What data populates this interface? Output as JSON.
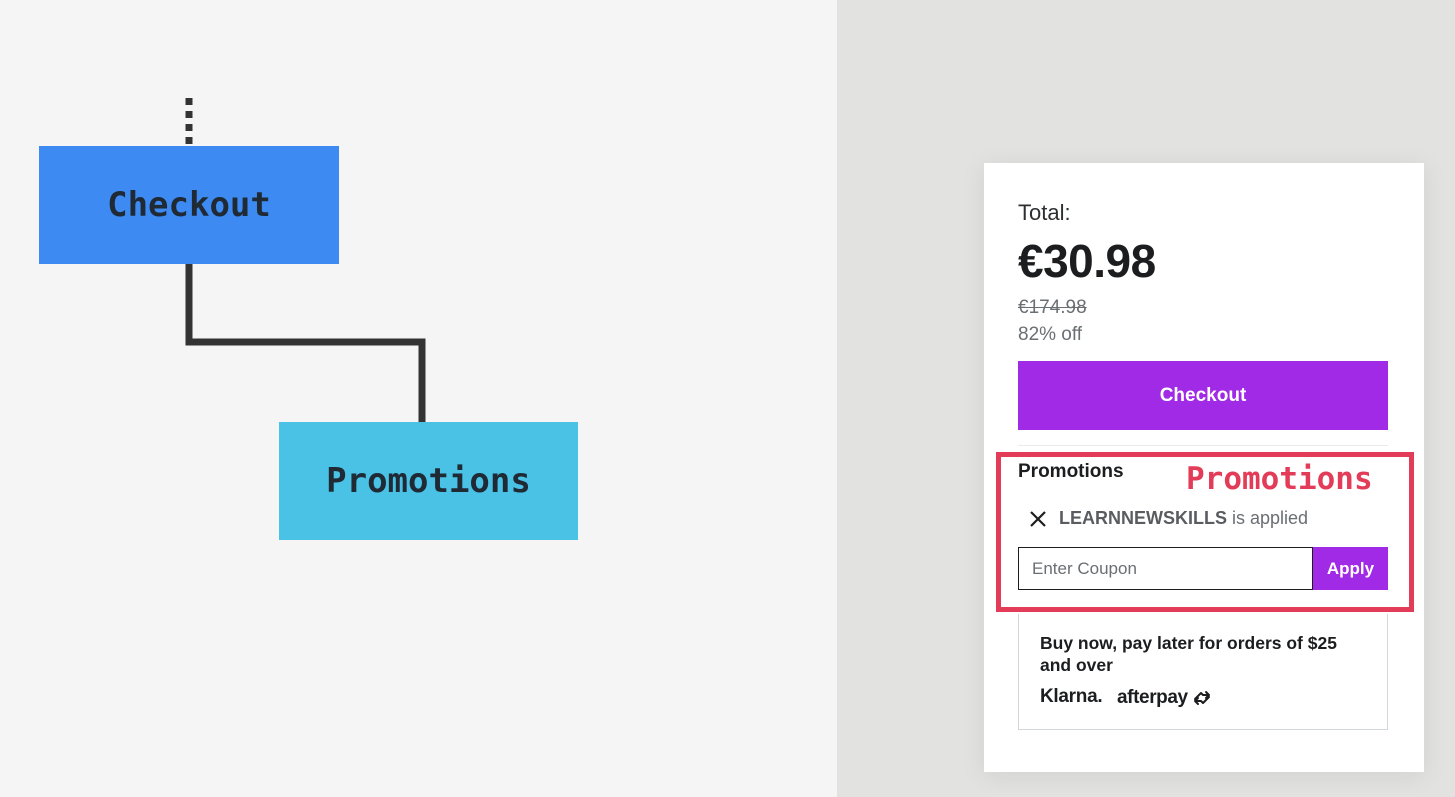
{
  "diagram": {
    "nodes": [
      {
        "id": "checkout",
        "label": "Checkout",
        "color": "#3d8af2"
      },
      {
        "id": "promotions",
        "label": "Promotions",
        "color": "#49c2e5"
      }
    ],
    "edges": [
      {
        "from": "checkout",
        "to": "promotions",
        "style": "solid"
      }
    ],
    "incoming_edge_style": "dotted"
  },
  "card": {
    "total_label": "Total:",
    "price": "€30.98",
    "original_price": "€174.98",
    "discount": "82% off",
    "checkout_label": "Checkout",
    "promotions_heading": "Promotions",
    "applied_code": "LEARNNEWSKILLS",
    "applied_suffix": "is applied",
    "coupon_placeholder": "Enter Coupon",
    "apply_label": "Apply",
    "bnpl_text": "Buy now, pay later for orders of $25 and over",
    "klarna_logo": "Klarna.",
    "afterpay_logo": "afterpay"
  },
  "highlight": {
    "label": "Promotions",
    "color": "#e33c58"
  },
  "colors": {
    "accent_purple": "#a02ae6",
    "checkout_node": "#3d8af2",
    "promotions_node": "#49c2e5"
  }
}
